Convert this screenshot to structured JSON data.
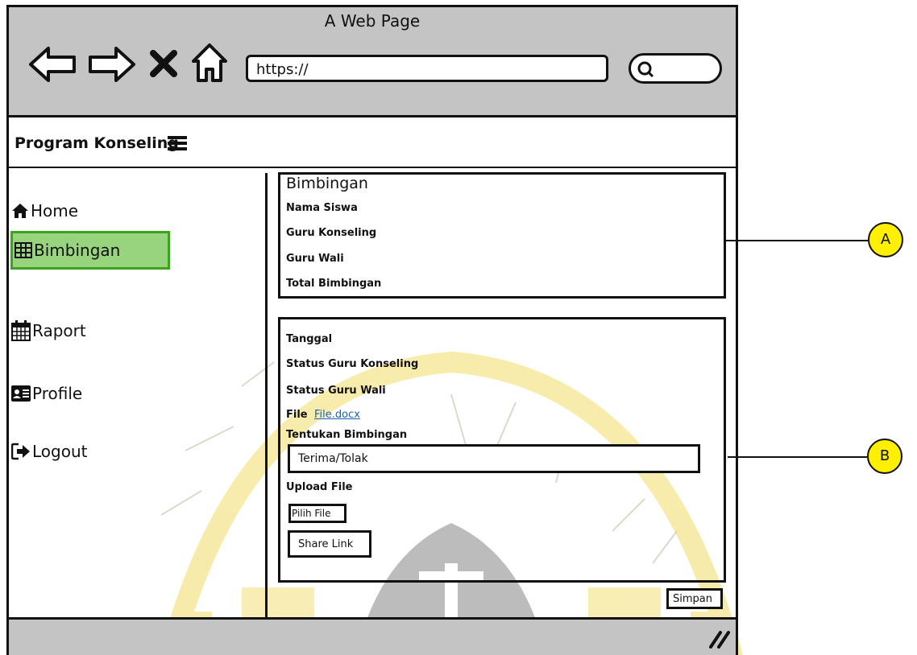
{
  "window": {
    "title": "A Web Page",
    "url": "https://"
  },
  "app": {
    "brand": "Program Konseling"
  },
  "sidebar": {
    "items": [
      {
        "label": "Home",
        "icon": "home-icon"
      },
      {
        "label": "Bimbingan",
        "icon": "table-icon",
        "active": true
      },
      {
        "label": "Raport",
        "icon": "calendar-icon"
      },
      {
        "label": "Profile",
        "icon": "id-card-icon"
      },
      {
        "label": "Logout",
        "icon": "sign-out-icon"
      }
    ]
  },
  "panel_a": {
    "title": "Bimbingan",
    "fields": [
      "Nama Siswa",
      "Guru Konseling",
      "Guru Wali",
      "Total Bimbingan"
    ]
  },
  "panel_b": {
    "tanggal": "Tanggal",
    "status_konseling": "Status Guru Konseling",
    "status_wali": "Status Guru Wali",
    "file_label": "File",
    "file_link": "File.docx",
    "tentukan_label": "Tentukan Bimbingan",
    "tentukan_value": "Terima/Tolak",
    "upload_label": "Upload File",
    "pilih_file": "Pilih File",
    "share_link": "Share Link"
  },
  "actions": {
    "save": "Simpan"
  },
  "callouts": {
    "a": "A",
    "b": "B"
  },
  "colors": {
    "chrome": "#c4c4c4",
    "active_item_bg": "#98d47d",
    "active_item_border": "#3aa31f",
    "callout": "#ffef00",
    "link": "#1f5fb0",
    "watermark": "#f2dc6a"
  }
}
